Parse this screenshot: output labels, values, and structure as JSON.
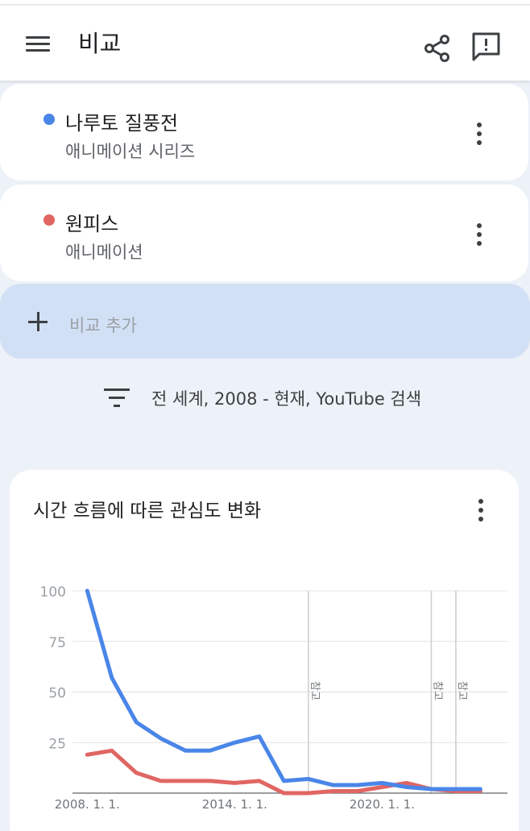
{
  "header": {
    "title": "비교",
    "icons": {
      "menu": "menu-icon",
      "share": "share-icon",
      "feedback": "feedback-icon"
    }
  },
  "terms": [
    {
      "name": "나루토 질풍전",
      "type": "애니메이션 시리즈",
      "color": "#4a86e8"
    },
    {
      "name": "원피스",
      "type": "애니메이션",
      "color": "#e06663"
    }
  ],
  "add_compare": {
    "label": "비교 추가"
  },
  "filter": {
    "text": "전 세계, 2008 - 현재, YouTube 검색"
  },
  "chart": {
    "title": "시간 흐름에 따른 관심도 변화"
  },
  "chart_data": {
    "type": "line",
    "title": "시간 흐름에 따른 관심도 변화",
    "x": [
      2008,
      2009,
      2010,
      2011,
      2012,
      2013,
      2014,
      2015,
      2016,
      2017,
      2018,
      2019,
      2020,
      2021,
      2022,
      2023,
      2024
    ],
    "x_tick_labels": [
      "2008. 1. 1.",
      "2014. 1. 1.",
      "2020. 1. 1."
    ],
    "x_tick_years": [
      2008,
      2014,
      2020
    ],
    "xlim": [
      2007.4,
      2025.1
    ],
    "ylim": [
      0,
      100
    ],
    "y_ticks": [
      25,
      50,
      75,
      100
    ],
    "grid": true,
    "series": [
      {
        "name": "나루토 질풍전",
        "color": "#4a86e8",
        "values": [
          100,
          57,
          35,
          27,
          21,
          21,
          25,
          28,
          6,
          7,
          4,
          4,
          5,
          3,
          2,
          2,
          2
        ]
      },
      {
        "name": "원피스",
        "color": "#e06663",
        "values": [
          19,
          21,
          10,
          6,
          6,
          6,
          5,
          6,
          0,
          0,
          1,
          1,
          3,
          5,
          2,
          1,
          1
        ]
      }
    ],
    "annotations": [
      {
        "x": 2017.0,
        "label": "참고"
      },
      {
        "x": 2022.0,
        "label": "참고"
      },
      {
        "x": 2023.0,
        "label": "참고"
      }
    ]
  }
}
